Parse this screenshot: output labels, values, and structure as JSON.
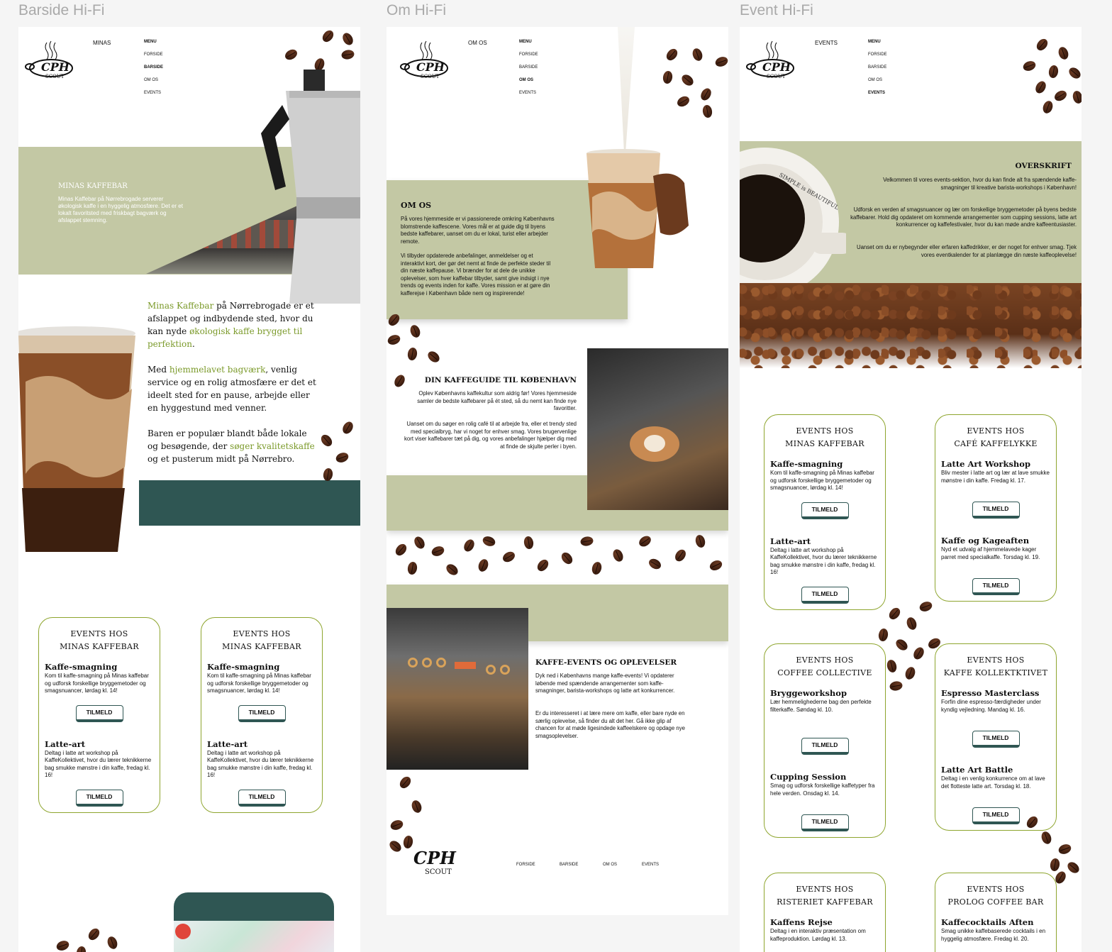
{
  "frames": {
    "barside": "Barside Hi-Fi",
    "om": "Om Hi-Fi",
    "event": "Event Hi-Fi"
  },
  "logo_text": "CPH SCOUT",
  "nav": {
    "menu": "MENU",
    "forside": "FORSIDE",
    "barside": "BARSIDE",
    "omos": "OM OS",
    "events": "EVENTS"
  },
  "barside": {
    "site_name": "MINAS",
    "hero_title": "MINAS KAFFEBAR",
    "hero_text": "Minas Kaffebar på Nørrebrogade serverer økologisk kaffe i en hyggelig atmosfære. Det er et lokalt favoritsted med friskbagt bagværk og afslappet stemning.",
    "p1_a": "Minas Kaffebar",
    "p1_b": " på Nørrebrogade er et afslappet og indbydende sted, hvor du kan nyde",
    "p1_c": " økologisk kaffe brygget til perfektion",
    "p1_d": ".",
    "p2_a": "Med ",
    "p2_b": "hjemmelavet bagværk",
    "p2_c": ", venlig service og en rolig atmosfære er det et ideelt sted for en pause, arbejde eller en hyggestund med venner.",
    "p3_a": "Baren er populær blandt både lokale og besøgende, der ",
    "p3_b": "søger kvalitetskaffe",
    "p3_c": " og et pusterum midt på Nørrebro.",
    "cards": [
      {
        "title1": "EVENTS HOS",
        "title2": "MINAS KAFFEBAR",
        "e1_name": "Kaffe-smagning",
        "e1_desc": "Kom til kaffe-smagning på Minas kaffebar og udforsk forskellige bryggemetoder og smagsnuancer, lørdag kl. 14!",
        "e2_name": "Latte-art",
        "e2_desc": "Deltag i latte art workshop på KaffeKollektivet, hvor du lærer teknikkerne bag smukke mønstre i din kaffe, fredag kl. 16!"
      },
      {
        "title1": "EVENTS HOS",
        "title2": "MINAS KAFFEBAR",
        "e1_name": "Kaffe-smagning",
        "e1_desc": "Kom til kaffe-smagning på Minas kaffebar og udforsk forskellige bryggemetoder og smagsnuancer, lørdag kl. 14!",
        "e2_name": "Latte-art",
        "e2_desc": "Deltag i latte art workshop på KaffeKollektivet, hvor du lærer teknikkerne bag smukke mønstre i din kaffe, fredag kl. 16!"
      }
    ],
    "button": "TILMELD"
  },
  "om": {
    "site_name": "OM OS",
    "omos_title": "OM OS",
    "omos_p1": "På vores hjemmeside er vi passionerede omkring Københavns blomstrende kaffescene. Vores mål er at guide dig til byens bedste kaffebarer, uanset om du er lokal, turist eller arbejder remote.",
    "omos_p2": "Vi tilbyder opdaterede anbefalinger, anmeldelser og et interaktivt kort, der gør det nemt at finde de perfekte steder til din næste kaffepause. Vi brænder for at dele de unikke oplevelser, som hver kaffebar tilbyder, samt give indsigt i nye trends og events inden for kaffe. Vores mission er at gøre din kafferejse i København både nem og inspirerende!",
    "guide_title": "DIN KAFFEGUIDE TIL KØBENHAVN",
    "guide_p1": "Oplev Københavns kaffekultur som aldrig før! Vores hjemmeside samler de bedste kaffebarer på ét sted, så du nemt kan finde nye favoritter.",
    "guide_p2": "Uanset om du søger en rolig café til at arbejde fra, eller et trendy sted med specialbryg, har vi noget for enhver smag. Vores brugervenlige kort viser kaffebarer tæt på dig, og vores anbefalinger hjælper dig med at finde de skjulte perler i byen.",
    "events_title": "KAFFE-EVENTS OG OPLEVELSER",
    "events_p1": "Dyk ned i Københavns mange kaffe-events! Vi opdaterer løbende med spændende arrangementer som kaffe-smagninger, barista-workshops og latte art konkurrencer.",
    "events_p2": "Er du interesseret i at lære mere om kaffe, eller bare nyde en særlig oplevelse, så finder du alt det her. Gå ikke glip af chancen for at møde ligesindede kaffeelskere og opdage nye smagsoplevelser.",
    "footer": [
      "FORSIDE",
      "BARSIDE",
      "OM OS",
      "EVENTS"
    ]
  },
  "event": {
    "site_name": "EVENTS",
    "overskrift": "OVERSKRIFT",
    "p1": "Velkommen til vores events-sektion, hvor du kan finde alt fra spændende kaffe-smagninger til kreative barista-workshops i København!",
    "p2": "Udforsk en verden af smagsnuancer og lær om forskellige bryggemetoder på byens bedste kaffebarer. Hold dig opdateret om kommende arrangementer som cupping sessions, latte art konkurrencer og kaffefestivaler, hvor du kan møde andre kaffeentusiaster.",
    "p3": "Uanset om du er nybegynder eller erfaren kaffedrikker, er der noget for enhver smag. Tjek vores eventkalender for at planlægge din næste kaffeoplevelse!",
    "cup_text": "SIMPLE is BEAUTIFUL",
    "cards": [
      {
        "title1": "EVENTS HOS",
        "title2": "MINAS KAFFEBAR",
        "e1_name": "Kaffe-smagning",
        "e1_desc": "Kom til kaffe-smagning på Minas kaffebar og udforsk forskellige bryggemetoder og smagsnuancer, lørdag kl. 14!",
        "e2_name": "Latte-art",
        "e2_desc": "Deltag i latte art workshop på KaffeKollektivet, hvor du lærer teknikkerne bag smukke mønstre i din kaffe, fredag kl. 16!"
      },
      {
        "title1": "EVENTS HOS",
        "title2": "CAFÉ KAFFELYKKE",
        "e1_name": "Latte Art Workshop",
        "e1_desc": "Bliv mester i latte art og lær at lave smukke mønstre i din kaffe. Fredag kl. 17.",
        "e2_name": "Kaffe og Kageaften",
        "e2_desc": "Nyd et udvalg af hjemmelavede kager parret med specialkaffe. Torsdag kl. 19."
      },
      {
        "title1": "EVENTS HOS",
        "title2": "COFFEE COLLECTIVE",
        "e1_name": "Bryggeworkshop",
        "e1_desc": "Lær hemmelighederne bag den perfekte filterkaffe. Søndag kl. 10.",
        "e2_name": "Cupping Session",
        "e2_desc": "Smag og udforsk forskellige kaffetyper fra hele verden. Onsdag kl. 14."
      },
      {
        "title1": "EVENTS HOS",
        "title2": "KAFFE KOLLEKTKTIVET",
        "e1_name": "Espresso Masterclass",
        "e1_desc": "Forfin dine espresso-færdigheder under kyndig vejledning. Mandag kl. 16.",
        "e2_name": "Latte Art Battle",
        "e2_desc": "Deltag i en venlig konkurrence om at lave det flotteste latte art. Torsdag kl. 18."
      },
      {
        "title1": "EVENTS HOS",
        "title2": "RISTERIET KAFFEBAR",
        "e1_name": "Kaffens Rejse",
        "e1_desc": "Deltag i en interaktiv præsentation om kaffeproduktion. Lørdag kl. 13."
      },
      {
        "title1": "EVENTS HOS",
        "title2": "PROLOG COFFEE BAR",
        "e1_name": "Kaffecocktails Aften",
        "e1_desc": "Smag unikke kaffebaserede cocktails i en hyggelig atmosfære. Fredag kl. 20."
      }
    ]
  }
}
